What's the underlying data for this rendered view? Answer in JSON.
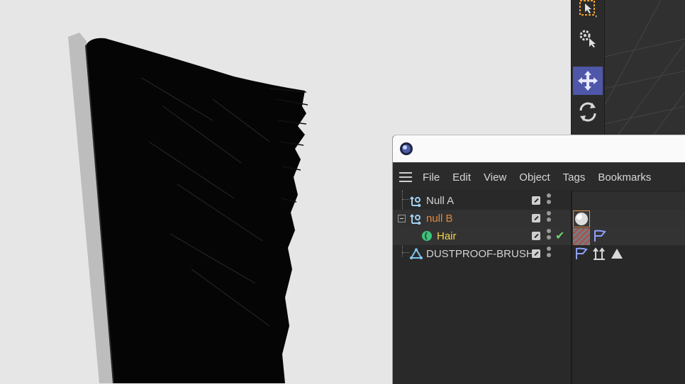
{
  "menu": {
    "items": [
      "File",
      "Edit",
      "View",
      "Object",
      "Tags",
      "Bookmarks"
    ]
  },
  "objects": [
    {
      "name": "Null A",
      "icon": "null-object-icon",
      "color": "#d2d2d2",
      "indent": 0,
      "expanded": null
    },
    {
      "name": "null B",
      "icon": "null-object-icon",
      "color": "#e08a3c",
      "indent": 0,
      "expanded": true
    },
    {
      "name": "Hair",
      "icon": "hair-object-icon",
      "color": "#f4d44a",
      "indent": 1,
      "expanded": null
    },
    {
      "name": "DUSTPROOF-BRUSH",
      "icon": "polygon-object-icon",
      "color": "#d2d2d2",
      "indent": 0,
      "expanded": null
    }
  ],
  "tags": {
    "null_b": [
      "material-sphere-tag-icon"
    ],
    "hair": [
      "hair-material-tag-icon",
      "phong-tag-icon"
    ],
    "dustproof_brush": [
      "phong-tag-icon",
      "normal-tag-icon",
      "display-tag-icon"
    ]
  },
  "tools": [
    "live-selection-icon",
    "tweak-icon",
    "move-icon",
    "rotate-icon"
  ],
  "colors": {
    "accent": "#4f57a8",
    "selected_object": "#e08a3c",
    "active_hair": "#f4d44a",
    "enabled_check": "#6dd36d"
  }
}
